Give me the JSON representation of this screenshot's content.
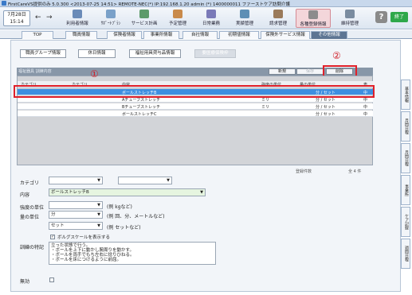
{
  "window": {
    "title": "FirstCareVS提供のみ 5.0.300 <2013-07-25 14:51> REMOTE-NEC(*) IP:192.168.1.20 admin (*) 1400000011 ファーストケア訪問介護"
  },
  "header": {
    "date_line1": "7月28日",
    "date_line2": "15:14",
    "toolbar": [
      {
        "label": "利用者情報",
        "color": "#6a8bb8"
      },
      {
        "label": "ｻﾎﾟｰﾄﾌﾟﾗﾝ",
        "color": "#7aa1c9"
      },
      {
        "label": "サービス計画",
        "color": "#5c9a6a"
      },
      {
        "label": "予定管理",
        "color": "#c98a4a"
      },
      {
        "label": "日常業務",
        "color": "#7a7ab8"
      },
      {
        "label": "実績管理",
        "color": "#5d8fb5"
      },
      {
        "label": "請求管理",
        "color": "#9a7a5a"
      },
      {
        "label": "各種登録情報",
        "color": "#8c8c8c"
      },
      {
        "label": "維持管理",
        "color": "#7a8ca0"
      }
    ],
    "help": "?",
    "exit": "終了"
  },
  "tabs": [
    "TOP",
    "職員情報",
    "保険者情報",
    "事業所情報",
    "自社情報",
    "初期値情報",
    "保険外サービス情報",
    "その他情報"
  ],
  "subbuttons": [
    "職員グループ情報",
    "休日情報",
    "福祉用具貸与品情報",
    "要医療保険枠"
  ],
  "grid": {
    "title": "福祉器具 訓練内容",
    "buttons": [
      "新規",
      "保存",
      "削除"
    ],
    "headers": [
      "カテゴリ",
      "カテゴリ",
      "内容",
      "強度の単位",
      "量の単位",
      "表"
    ],
    "rows": [
      {
        "content": "ボールストレッチB",
        "unit": "",
        "qty": "分 / セット",
        "flag": "中"
      },
      {
        "content": "Aチューブストレッチ",
        "unit": "ミリ",
        "qty": "分 / セット",
        "flag": "中"
      },
      {
        "content": "Bチューブストレッチ",
        "unit": "ミリ",
        "qty": "分 / セット",
        "flag": "中"
      },
      {
        "content": "ボールストレッチC",
        "unit": "",
        "qty": "分 / セット",
        "flag": "中"
      }
    ],
    "count_label": "登録件数",
    "count_value": "全 4 件"
  },
  "form": {
    "category_label": "カテゴリ",
    "content_label": "内容",
    "content_value": "ボールストレッチB",
    "strength_label": "強度の単位",
    "strength_hint": "(例 kgなど)",
    "qty_label": "量の単位",
    "qty_value1": "分",
    "qty_hint1": "(例 回、分、メートルなど)",
    "qty_value2": "セット",
    "qty_hint2": "(例 セットなど)",
    "scale_checkbox": "ボルグスケールを表示する",
    "notes_label": "訓練の特記",
    "notes_lines": [
      "立った状態で行う。",
      "・ボールを上下に動かし腕周りを動かす。",
      "・ボールを両手でもち左右に捻りひねる。",
      "・ボールを床につけるように前屈。"
    ],
    "valid_label": "無効"
  },
  "annotations": {
    "one": "①",
    "two": "②"
  },
  "side_tabs": [
    "基本情報",
    "月間日程",
    "月間日程",
    "事業所",
    "ケア記録",
    "週間日程"
  ]
}
